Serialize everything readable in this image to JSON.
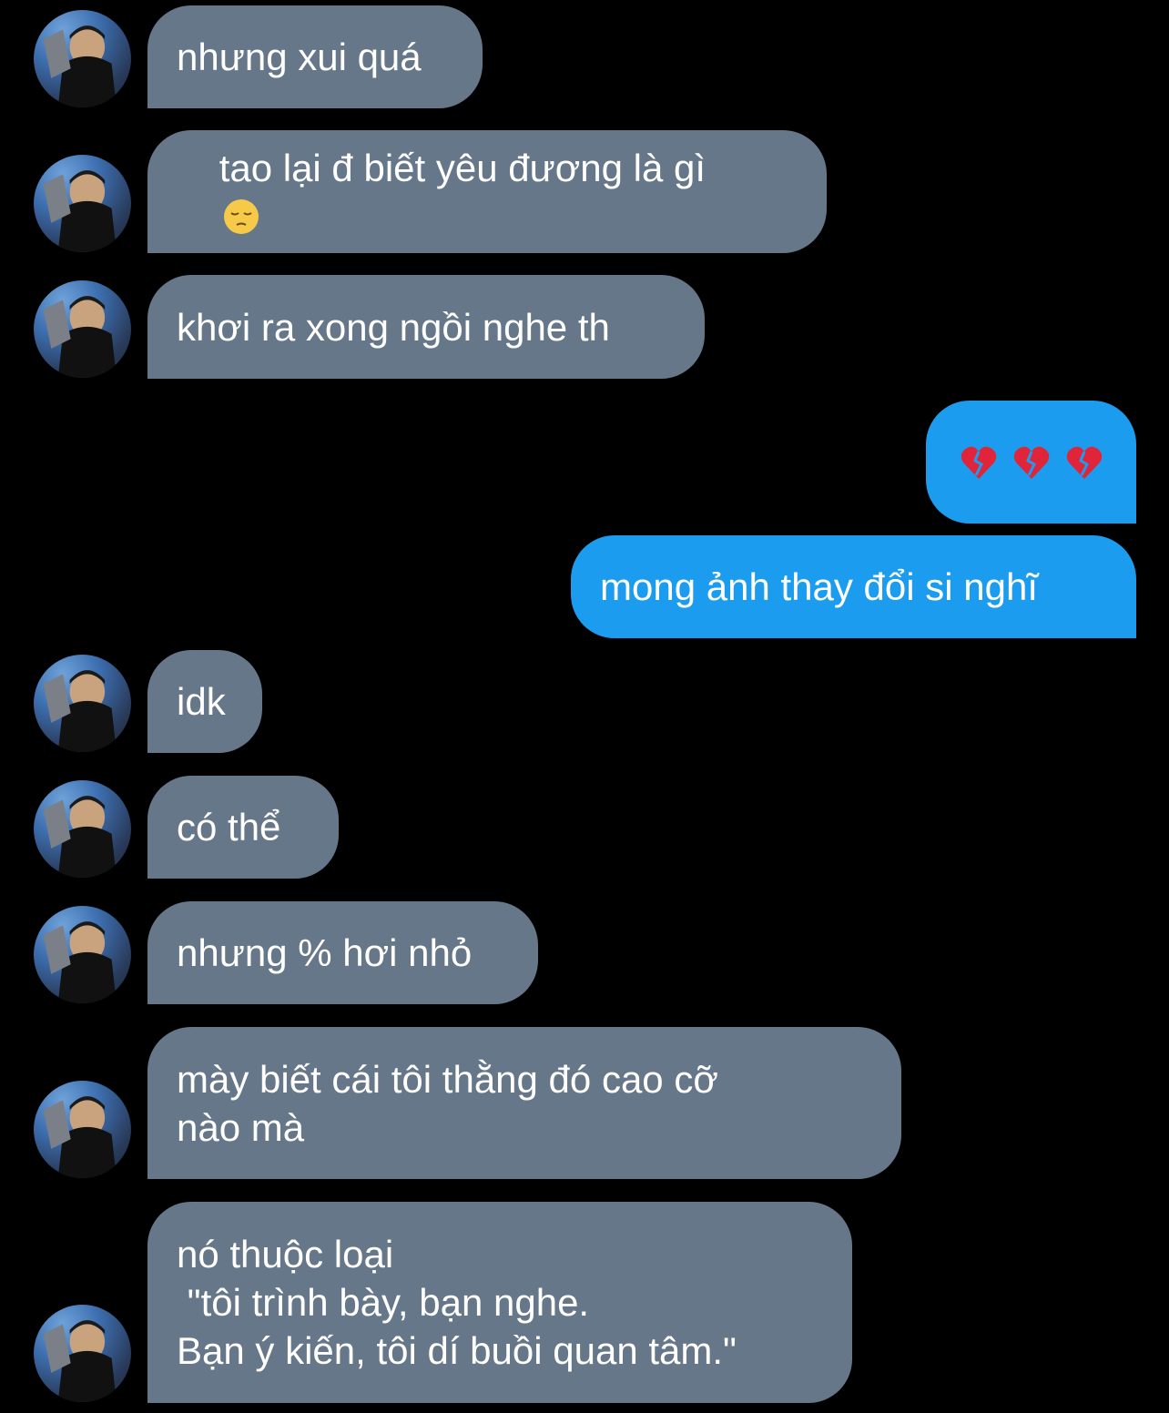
{
  "conversation": {
    "messages": [
      {
        "sender": "them",
        "text": "nhưng xui quá"
      },
      {
        "sender": "them",
        "text": "tao lại đ biết yêu đương là gì",
        "emoji": "pensive-face"
      },
      {
        "sender": "them",
        "text": "khơi ra xong ngồi nghe th"
      },
      {
        "sender": "me",
        "emoji": "broken-heart x3"
      },
      {
        "sender": "me",
        "text": "mong ảnh thay đổi si nghĩ"
      },
      {
        "sender": "them",
        "text": "idk"
      },
      {
        "sender": "them",
        "text": "có thể"
      },
      {
        "sender": "them",
        "text": "nhưng % hơi nhỏ"
      },
      {
        "sender": "them",
        "text": "mày biết cái tôi thằng đó cao cỡ\nnào mà"
      },
      {
        "sender": "them",
        "text": "nó thuộc loại\n \"tôi trình bày, bạn nghe.\nBạn ý kiến, tôi dí buồi quan tâm.\""
      }
    ]
  },
  "colors": {
    "background": "#000000",
    "incoming_bubble": "#66778a",
    "outgoing_bubble": "#1c9cef",
    "text": "#ffffff"
  }
}
